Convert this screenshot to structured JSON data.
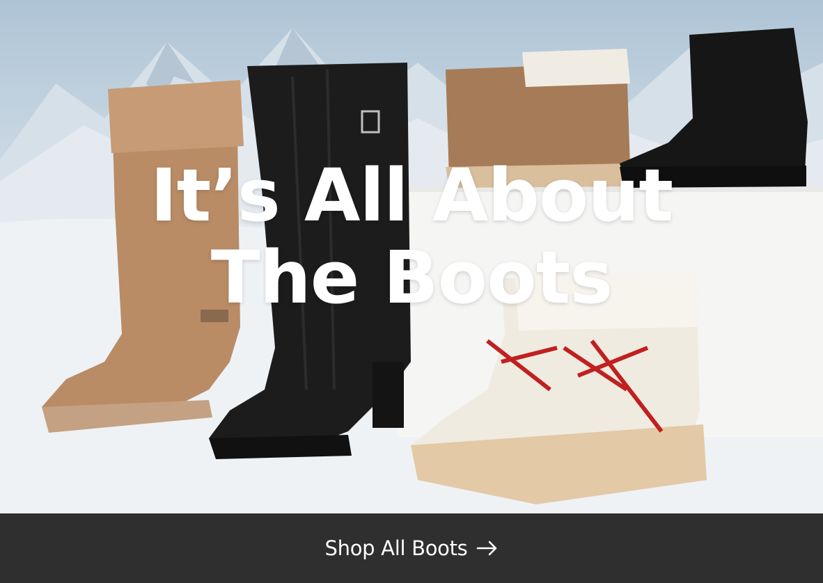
{
  "hero": {
    "headline_line1": "It’s All About",
    "headline_line2": "The Boots",
    "image_description_icon": "boots-photo"
  },
  "cta": {
    "label": "Shop All Boots",
    "arrow_icon": "arrow-right-icon"
  },
  "colors": {
    "cta_background": "#2f2f2f",
    "text": "#ffffff"
  }
}
